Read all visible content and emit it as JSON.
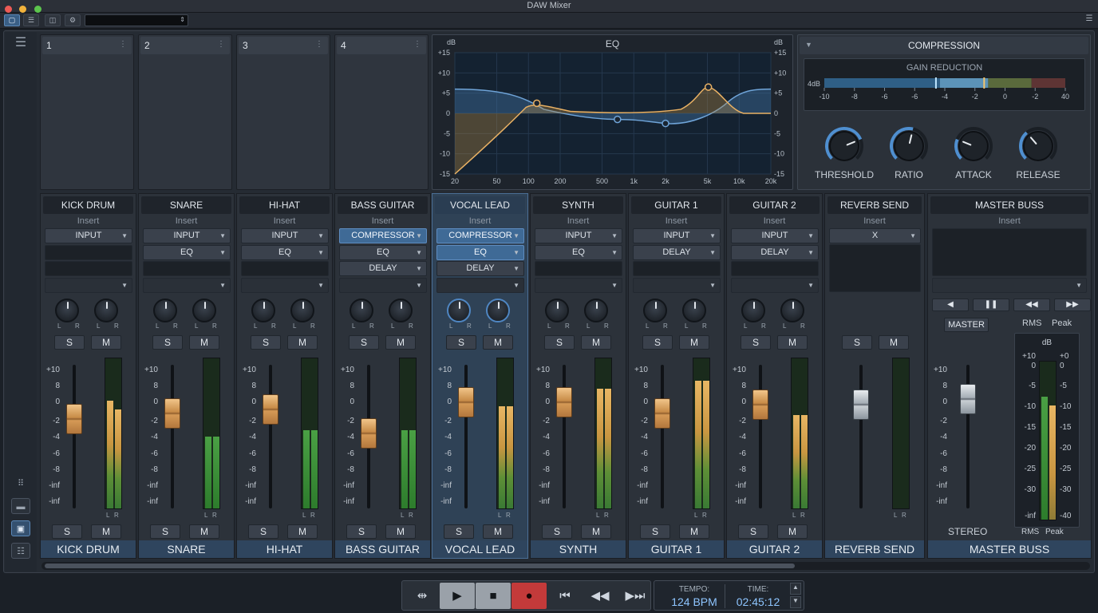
{
  "window": {
    "title": "DAW Mixer"
  },
  "toolbar": {
    "icons": [
      "mixer-view-icon",
      "tracks-icon",
      "split-view-icon",
      "gear-icon"
    ],
    "menu_icon": "hamburger-icon"
  },
  "sidebar": {
    "icons": [
      "hamburger-icon",
      "grid-icon",
      "folder-icon",
      "mixer-icon",
      "sliders-icon"
    ]
  },
  "insert_slots": [
    {
      "number": "1"
    },
    {
      "number": "2"
    },
    {
      "number": "3"
    },
    {
      "number": "4"
    }
  ],
  "eq": {
    "title": "EQ",
    "db_unit": "dB",
    "db_ticks": [
      "+15",
      "+10",
      "+5",
      "0",
      "-5",
      "-10",
      "-15"
    ],
    "freq_ticks": [
      "20",
      "50",
      "100",
      "200",
      "500",
      "1k",
      "2k",
      "5k",
      "10k",
      "20k"
    ]
  },
  "compression": {
    "title": "COMPRESSION",
    "gain_reduction_title": "GAIN REDUCTION",
    "gr_unit": "4dB",
    "gr_ticks": [
      "-10",
      "-8",
      "-6",
      "-6",
      "-4",
      "-2",
      "0",
      "-2",
      "40"
    ],
    "knobs": [
      {
        "label": "THRESHOLD",
        "value": 0.75
      },
      {
        "label": "RATIO",
        "value": 0.55
      },
      {
        "label": "ATTACK",
        "value": 0.25
      },
      {
        "label": "RELEASE",
        "value": 0.35
      }
    ]
  },
  "fader_scale": [
    "+10",
    "8",
    "0",
    "-2",
    "-4",
    "-6",
    "-8",
    "-inf",
    "-inf"
  ],
  "strip_labels": {
    "insert": "Insert",
    "solo": "S",
    "mute": "M",
    "left": "L",
    "right": "R"
  },
  "channels": [
    {
      "name": "KICK DRUM",
      "inserts": [
        {
          "label": "INPUT",
          "style": "normal"
        },
        {
          "label": "",
          "style": "empty"
        },
        {
          "label": "",
          "style": "empty"
        },
        {
          "label": "",
          "style": "dark"
        }
      ],
      "fader": 0.62,
      "meter": [
        0.72,
        0.66
      ],
      "selected": false
    },
    {
      "name": "SNARE",
      "inserts": [
        {
          "label": "INPUT",
          "style": "normal"
        },
        {
          "label": "EQ",
          "style": "normal"
        },
        {
          "label": "",
          "style": "empty"
        },
        {
          "label": "",
          "style": "dark"
        }
      ],
      "fader": 0.66,
      "meter": [
        0.48,
        0.48
      ],
      "selected": false
    },
    {
      "name": "HI-HAT",
      "inserts": [
        {
          "label": "INPUT",
          "style": "normal"
        },
        {
          "label": "EQ",
          "style": "normal"
        },
        {
          "label": "",
          "style": "empty"
        },
        {
          "label": "",
          "style": "dark"
        }
      ],
      "fader": 0.69,
      "meter": [
        0.52,
        0.52
      ],
      "selected": false
    },
    {
      "name": "BASS GUITAR",
      "inserts": [
        {
          "label": "COMPRESSOR",
          "style": "blue"
        },
        {
          "label": "EQ",
          "style": "normal"
        },
        {
          "label": "DELAY",
          "style": "normal"
        },
        {
          "label": "",
          "style": "dark"
        }
      ],
      "fader": 0.52,
      "meter": [
        0.52,
        0.52
      ],
      "selected": false
    },
    {
      "name": "VOCAL LEAD",
      "inserts": [
        {
          "label": "COMPRESSOR",
          "style": "blue"
        },
        {
          "label": "EQ",
          "style": "blue"
        },
        {
          "label": "DELAY",
          "style": "normal"
        },
        {
          "label": "",
          "style": "dark"
        }
      ],
      "fader": 0.74,
      "meter": [
        0.68,
        0.68
      ],
      "selected": true
    },
    {
      "name": "SYNTH",
      "inserts": [
        {
          "label": "INPUT",
          "style": "normal"
        },
        {
          "label": "EQ",
          "style": "normal"
        },
        {
          "label": "",
          "style": "empty"
        },
        {
          "label": "",
          "style": "dark"
        }
      ],
      "fader": 0.74,
      "meter": [
        0.8,
        0.8
      ],
      "selected": false
    },
    {
      "name": "GUITAR 1",
      "inserts": [
        {
          "label": "INPUT",
          "style": "normal"
        },
        {
          "label": "DELAY",
          "style": "normal"
        },
        {
          "label": "",
          "style": "empty"
        },
        {
          "label": "",
          "style": "dark"
        }
      ],
      "fader": 0.66,
      "meter": [
        0.85,
        0.85
      ],
      "selected": false
    },
    {
      "name": "GUITAR 2",
      "inserts": [
        {
          "label": "INPUT",
          "style": "normal"
        },
        {
          "label": "DELAY",
          "style": "normal"
        },
        {
          "label": "",
          "style": "empty"
        },
        {
          "label": "",
          "style": "dark"
        }
      ],
      "fader": 0.72,
      "meter": [
        0.62,
        0.62
      ],
      "selected": false
    }
  ],
  "reverb_send": {
    "name": "REVERB SEND",
    "insert": "X",
    "fader": 0.72
  },
  "master": {
    "name": "MASTER BUSS",
    "insert_label": "Insert",
    "controls": [
      "◀",
      "❚❚",
      "◀◀",
      "▶▶"
    ],
    "master_button": "MASTER",
    "rms_label": "RMS",
    "peak_label": "Peak",
    "stereo_label": "STEREO",
    "meter_unit": "dB",
    "meter_scale_left": [
      "+10",
      "0",
      "-5",
      "-10",
      "-15",
      "-20",
      "-25",
      "-30",
      "-inf"
    ],
    "meter_scale_right": [
      "+0",
      "0",
      "-5",
      "-10",
      "-15",
      "-20",
      "-25",
      "-30",
      "-40"
    ],
    "fader": 0.76,
    "meter": [
      0.78,
      0.72
    ]
  },
  "transport": {
    "buttons": [
      {
        "name": "loop-button",
        "glyph": "⇹"
      },
      {
        "name": "play-button",
        "glyph": "▶"
      },
      {
        "name": "stop-button",
        "glyph": "■"
      },
      {
        "name": "record-button",
        "glyph": "●"
      },
      {
        "name": "skip-back-button",
        "glyph": "⏮"
      },
      {
        "name": "rewind-button",
        "glyph": "◀◀"
      },
      {
        "name": "skip-forward-button",
        "glyph": "▶⏭"
      }
    ],
    "tempo_label": "TEMPO:",
    "tempo_value": "124 BPM",
    "time_label": "TIME:",
    "time_value": "02:45:12"
  },
  "colors": {
    "accent": "#5b88b8",
    "meter_green": "#3f8f3a",
    "meter_amber": "#d6a24a",
    "record": "#c33a3a"
  }
}
